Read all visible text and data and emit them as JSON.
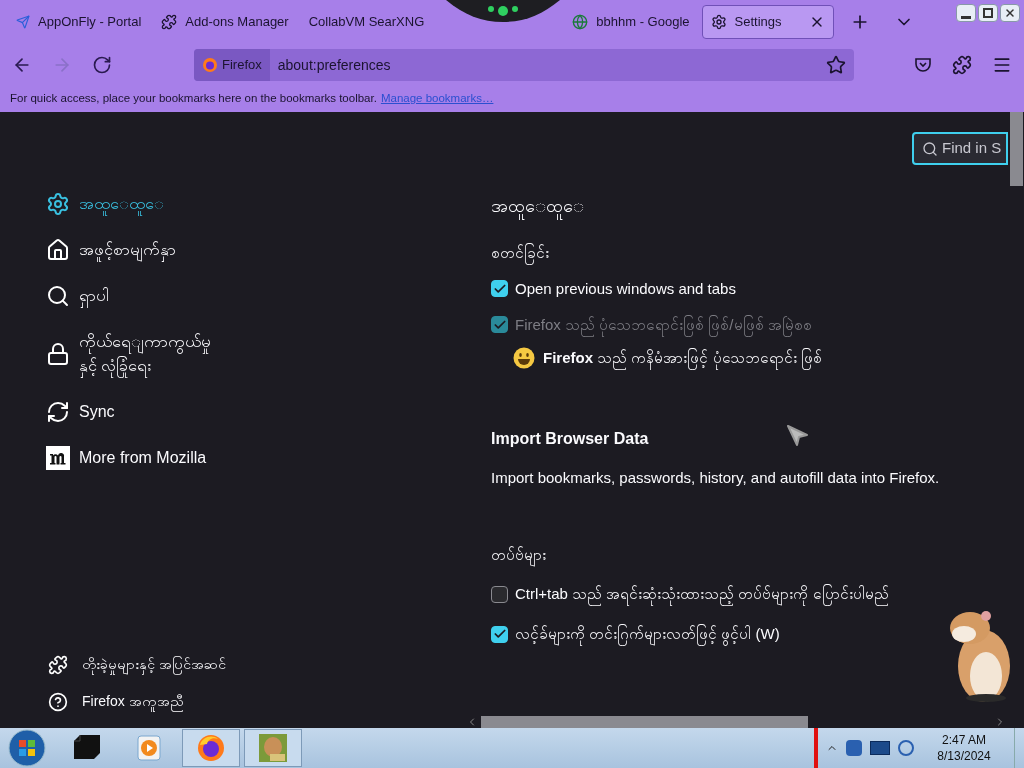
{
  "browser_tabs": [
    {
      "label": "AppOnFly - Portal",
      "kind": "plane",
      "selected": false
    },
    {
      "label": "Add-ons Manager",
      "kind": "puzzle",
      "selected": false
    },
    {
      "label": "CollabVM SearXNG",
      "kind": "none",
      "selected": false
    },
    {
      "label": "bbhhm - Google",
      "kind": "globe",
      "selected": false
    },
    {
      "label": "Settings",
      "kind": "gear",
      "selected": true
    }
  ],
  "address": {
    "identity": "Firefox",
    "url": "about:preferences"
  },
  "bookmarks_bar": {
    "text": "For quick access, place your bookmarks here on the bookmarks toolbar.",
    "link": "Manage bookmarks…"
  },
  "find": {
    "placeholder": "Find in S"
  },
  "sidebar": {
    "items": [
      {
        "label": "အထူေထူေ",
        "kind": "gear",
        "selected": true
      },
      {
        "label": "အဖူင့်စာမျက်နှာ",
        "kind": "home",
        "selected": false
      },
      {
        "label": "ရှာပါ",
        "kind": "search",
        "selected": false
      },
      {
        "label": "ကိုယ်ရေျကာကွယ်မှု\nနှင့် လုံခြုံရေး",
        "kind": "lock",
        "selected": false
      },
      {
        "label": "Sync",
        "kind": "sync",
        "selected": false
      },
      {
        "label": "More from Mozilla",
        "kind": "mozilla",
        "selected": false
      }
    ],
    "footer": [
      {
        "label": "တိုးခဲ့မှုများနှင့် အပြင်အဆင်",
        "kind": "puzzle"
      },
      {
        "label": "Firefox အကူအညီ",
        "kind": "help"
      }
    ]
  },
  "content": {
    "heading": "အထူေထူေ",
    "startup": {
      "heading": "စတင်ခြင်း",
      "options": [
        {
          "kind": "checkbox",
          "label": "Open previous windows and tabs",
          "checked": true,
          "disabled": false
        },
        {
          "kind": "checkbox",
          "label": "Firefox သည် ပုံသေဘရောင်းဖြစ် ဖြစ်/မဖြစ် အမြဲစစ",
          "checked": true,
          "disabled": true
        },
        {
          "kind": "note",
          "label": "**Firefox** သည် ကနိမံအားဖြင့် ပုံသေဘရောင်း ဖြစ်"
        }
      ]
    },
    "import": {
      "title": "Import Browser Data",
      "text": "Import bookmarks, passwords, history, and autofill data into Firefox."
    },
    "tabs": {
      "heading": "တပ်ဗ်များ",
      "options": [
        {
          "kind": "checkbox",
          "label": "Ctrl+tab သည် အရင်းဆုံးသုံးထားသည့် တပ်ဗ်များကို ပြောင်းပါမည်",
          "checked": false,
          "disabled": false
        },
        {
          "kind": "checkbox",
          "label": "လင့်ခ်များကို တင်းဂြက်များလတ်ဖြင့် ဖွင့်ပါ (W)",
          "checked": true,
          "disabled": false
        }
      ]
    }
  },
  "taskbar": {
    "apps": [
      {
        "kind": "media",
        "selected": false
      },
      {
        "kind": "player",
        "selected": false
      },
      {
        "kind": "firefox",
        "selected": true
      },
      {
        "kind": "box",
        "selected": true
      }
    ],
    "time": "2:47 AM",
    "date": "8/13/2024"
  }
}
